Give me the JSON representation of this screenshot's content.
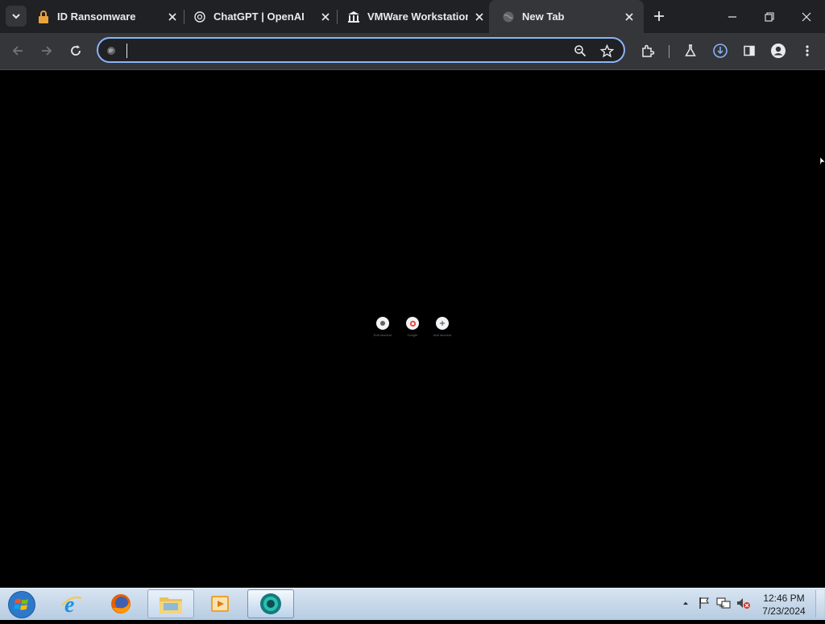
{
  "browser": {
    "tabs": [
      {
        "title": "ID Ransomware",
        "icon": "padlock-icon",
        "active": false
      },
      {
        "title": "ChatGPT | OpenAI",
        "icon": "openai-icon",
        "active": false
      },
      {
        "title": "VMWare Workstation",
        "icon": "bank-icon",
        "active": false
      },
      {
        "title": "New Tab",
        "icon": "globe-icon",
        "active": true
      }
    ],
    "omnibox": {
      "value": "",
      "placeholder": ""
    }
  },
  "shortcuts": [
    {
      "label": "Edit shortcut",
      "icon": "shortcut-icon"
    },
    {
      "label": "Google",
      "icon": "google-icon"
    },
    {
      "label": "Add shortcut",
      "icon": "add-icon"
    }
  ],
  "taskbar": {
    "apps": [
      "internet-explorer-icon",
      "firefox-icon",
      "file-explorer-icon",
      "media-player-icon",
      "chrome-canary-icon"
    ],
    "clock": {
      "time": "12:46 PM",
      "date": "7/23/2024"
    }
  },
  "colors": {
    "accent": "#8ab4f8",
    "tab_bg": "#202124",
    "toolbar_bg": "#35363a",
    "page_bg": "#000000"
  }
}
